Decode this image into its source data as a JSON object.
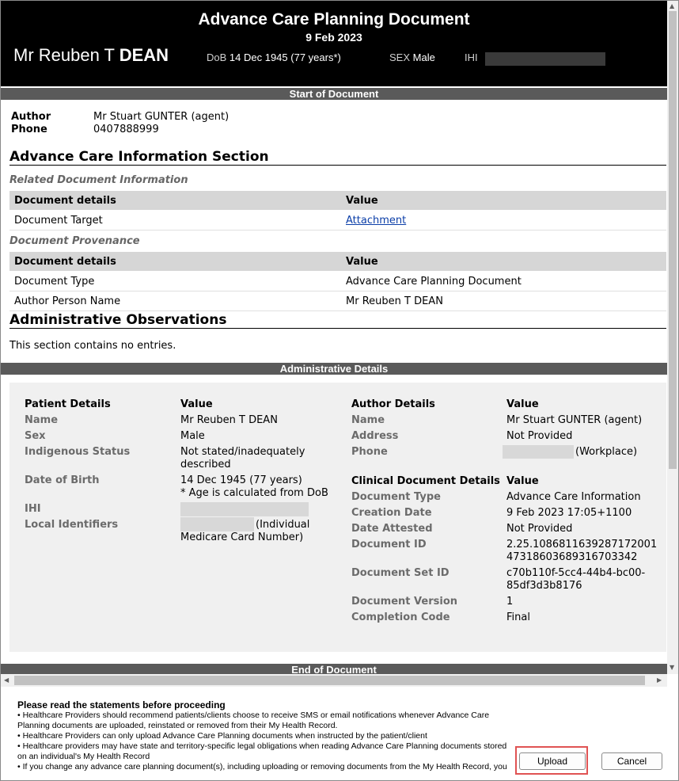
{
  "header": {
    "title": "Advance Care Planning Document",
    "date": "9 Feb 2023",
    "patient_prefix": "Mr Reuben T",
    "patient_surname": "DEAN",
    "dob_label": "DoB",
    "dob_value": "14 Dec 1945 (77 years*)",
    "sex_label": "SEX",
    "sex_value": "Male",
    "ihi_label": "IHI"
  },
  "bars": {
    "start": "Start of Document",
    "admin": "Administrative Details",
    "end": "End of Document"
  },
  "author": {
    "author_label": "Author",
    "author_value": "Mr Stuart GUNTER (agent)",
    "phone_label": "Phone",
    "phone_value": "0407888999"
  },
  "advance_care": {
    "heading": "Advance Care Information Section",
    "related_heading": "Related Document Information",
    "related_cols": [
      "Document details",
      "Value"
    ],
    "related_rows": [
      {
        "detail": "Document Target",
        "value": "Attachment"
      }
    ],
    "provenance_heading": "Document Provenance",
    "provenance_cols": [
      "Document details",
      "Value"
    ],
    "provenance_rows": [
      {
        "detail": "Document Type",
        "value": "Advance Care Planning Document"
      },
      {
        "detail": "Author Person Name",
        "value": "Mr Reuben T DEAN"
      }
    ]
  },
  "admin_obs": {
    "heading": "Administrative Observations",
    "text": "This section contains no entries."
  },
  "patient_details": {
    "heading": "Patient Details",
    "value_heading": "Value",
    "name_label": "Name",
    "name_value": "Mr Reuben T DEAN",
    "sex_label": "Sex",
    "sex_value": "Male",
    "indigenous_label": "Indigenous Status",
    "indigenous_value_1": "Not stated/inadequately",
    "indigenous_value_2": "described",
    "dob_label": "Date of Birth",
    "dob_value": "14 Dec 1945 (77 years)",
    "dob_note": "* Age is calculated from DoB",
    "ihi_label": "IHI",
    "local_label": "Local Identifiers",
    "local_value_1": "(Individual",
    "local_value_2": "Medicare Card Number)"
  },
  "author_details": {
    "heading": "Author Details",
    "value_heading": "Value",
    "name_label": "Name",
    "name_value": "Mr Stuart GUNTER (agent)",
    "address_label": "Address",
    "address_value": "Not Provided",
    "phone_label": "Phone",
    "phone_value": "(Workplace)"
  },
  "clinical_details": {
    "heading": "Clinical Document Details",
    "value_heading": "Value",
    "type_label": "Document Type",
    "type_value": "Advance Care Information",
    "created_label": "Creation Date",
    "created_value": "9 Feb 2023 17:05+1100",
    "attested_label": "Date Attested",
    "attested_value": "Not Provided",
    "docid_label": "Document ID",
    "docid_value_1": "2.25.1086811639287172001",
    "docid_value_2": "47318603689316703342",
    "setid_label": "Document Set ID",
    "setid_value_1": "c70b110f-5cc4-44b4-bc00-",
    "setid_value_2": "85df3d3b8176",
    "version_label": "Document Version",
    "version_value": "1",
    "completion_label": "Completion Code",
    "completion_value": "Final"
  },
  "footer": {
    "title": "Please read the statements before proceeding",
    "lines": [
      "• Healthcare Providers should recommend patients/clients choose to receive SMS or email notifications whenever Advance Care",
      "Planning documents are uploaded, reinstated or removed from their My Health Record.",
      "• Healthcare Providers can only upload Advance Care Planning documents when instructed by the patient/client",
      "• Healthcare providers may have state and territory-specific legal obligations when reading Advance Care Planning documents stored",
      "on an individual's My Health Record",
      "• If you change any advance care planning document(s), including uploading or removing documents from the My Health Record, you"
    ],
    "upload_label": "Upload",
    "cancel_label": "Cancel"
  },
  "colors": {
    "header_bg": "#000000",
    "section_bar": "#5a5a5a",
    "table_head": "#d6d6d6",
    "admin_panel": "#f0f0f0",
    "link": "#0b3ea8",
    "highlight": "#e05353"
  }
}
